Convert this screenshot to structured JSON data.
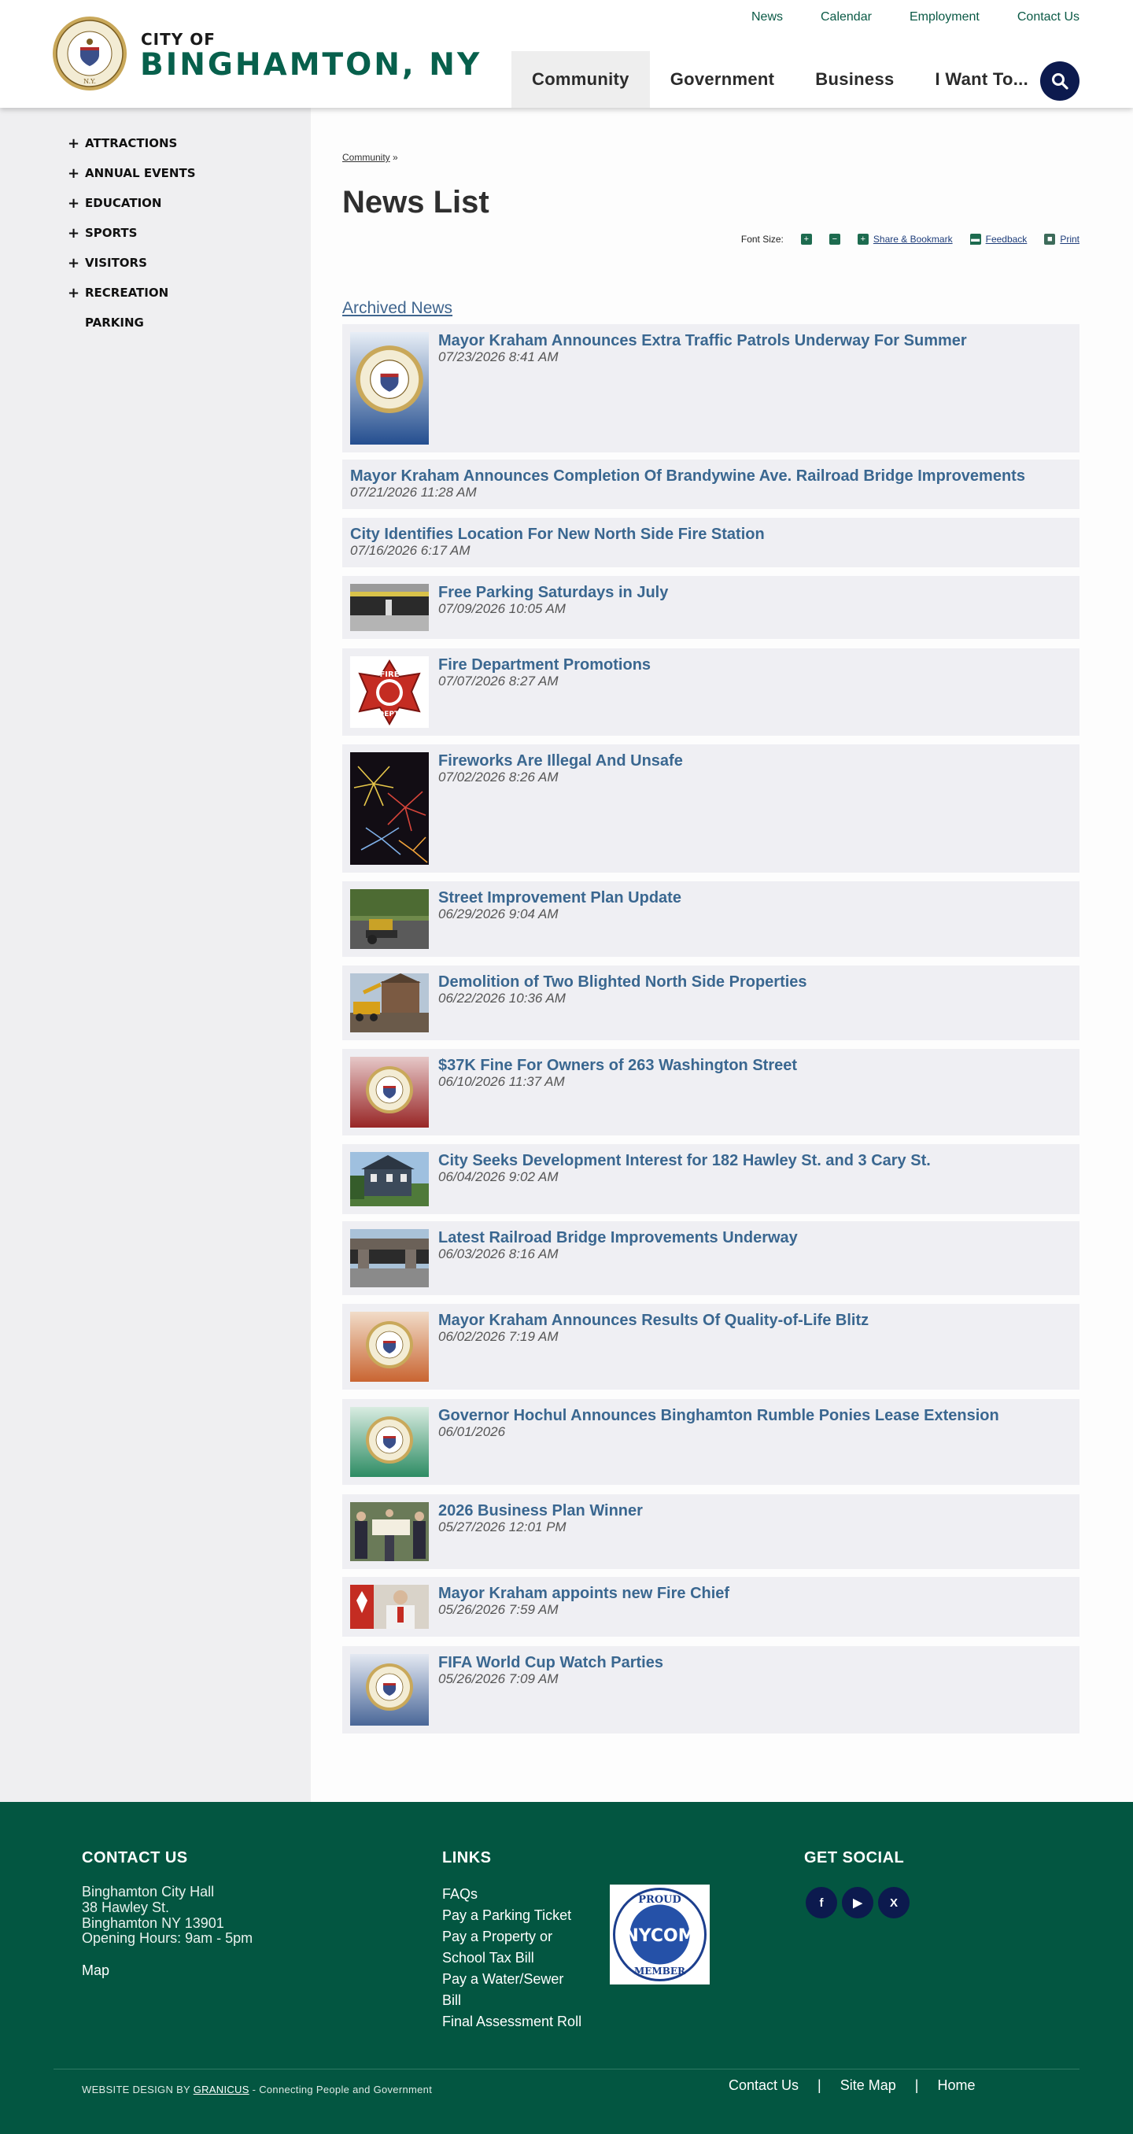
{
  "header": {
    "city_of": "CITY OF",
    "city_name": "BINGHAMTON, NY",
    "utility_nav": [
      "News",
      "Calendar",
      "Employment",
      "Contact Us"
    ],
    "main_nav": [
      "Community",
      "Government",
      "Business",
      "I Want To..."
    ],
    "search_icon": "search-icon"
  },
  "sidebar": {
    "items": [
      {
        "label": "ATTRACTIONS",
        "expandable": true
      },
      {
        "label": "ANNUAL EVENTS",
        "expandable": true
      },
      {
        "label": "EDUCATION",
        "expandable": true
      },
      {
        "label": "SPORTS",
        "expandable": true
      },
      {
        "label": "VISITORS",
        "expandable": true
      },
      {
        "label": "RECREATION",
        "expandable": true
      },
      {
        "label": "PARKING",
        "expandable": false
      }
    ]
  },
  "main": {
    "breadcrumb": "Community",
    "breadcrumb_sep": "»",
    "title": "News List",
    "tools": {
      "font_size_label": "Font Size:",
      "share_label": "Share & Bookmark",
      "feedback_label": "Feedback",
      "print_label": "Print"
    },
    "archived_label": "Archived News",
    "news": [
      {
        "title": "Mayor Kraham Announces Extra Traffic Patrols Underway For Summer",
        "date": "07/23/2026 8:41 AM",
        "thumb": "seal-blue"
      },
      {
        "title": "Mayor Kraham Announces Completion Of Brandywine Ave. Railroad Bridge Improvements",
        "date": "07/21/2026 11:28 AM",
        "thumb": "none"
      },
      {
        "title": "City Identifies Location For New North Side Fire Station",
        "date": "07/16/2026 6:17 AM",
        "thumb": "none"
      },
      {
        "title": "Free Parking Saturdays in July",
        "date": "07/09/2026 10:05 AM",
        "thumb": "parking-garage"
      },
      {
        "title": "Fire Department Promotions",
        "date": "07/07/2026 8:27 AM",
        "thumb": "fire-dept-logo"
      },
      {
        "title": "Fireworks Are Illegal And Unsafe",
        "date": "07/02/2026 8:26 AM",
        "thumb": "fireworks"
      },
      {
        "title": "Street Improvement Plan Update",
        "date": "06/29/2026 9:04 AM",
        "thumb": "street-paving"
      },
      {
        "title": "Demolition of Two Blighted North Side Properties",
        "date": "06/22/2026 10:36 AM",
        "thumb": "demolition"
      },
      {
        "title": "$37K Fine For Owners of 263 Washington Street",
        "date": "06/10/2026 11:37 AM",
        "thumb": "seal-red"
      },
      {
        "title": "City Seeks Development Interest for 182 Hawley St. and 3 Cary St.",
        "date": "06/04/2026 9:02 AM",
        "thumb": "house"
      },
      {
        "title": "Latest Railroad Bridge Improvements Underway",
        "date": "06/03/2026 8:16 AM",
        "thumb": "bridge"
      },
      {
        "title": "Mayor Kraham Announces Results Of Quality-of-Life Blitz",
        "date": "06/02/2026 7:19 AM",
        "thumb": "seal-orange"
      },
      {
        "title": "Governor Hochul Announces Binghamton Rumble Ponies Lease Extension",
        "date": "06/01/2026",
        "thumb": "seal-green"
      },
      {
        "title": "2026 Business Plan Winner",
        "date": "05/27/2026 12:01 PM",
        "thumb": "check-presentation"
      },
      {
        "title": "Mayor Kraham appoints new Fire Chief",
        "date": "05/26/2026 7:59 AM",
        "thumb": "fire-chief"
      },
      {
        "title": "FIFA World Cup Watch Parties",
        "date": "05/26/2026 7:09 AM",
        "thumb": "seal-navy"
      }
    ]
  },
  "footer": {
    "contact": {
      "heading": "CONTACT US",
      "lines": [
        "Binghamton City Hall",
        "38 Hawley St.",
        "Binghamton NY 13901",
        "Opening Hours: 9am - 5pm"
      ],
      "map_label": "Map"
    },
    "links": {
      "heading": "LINKS",
      "items": [
        "FAQs",
        "Pay a Parking Ticket",
        "Pay a Property or",
        "School Tax Bill",
        "Pay a Water/Sewer",
        "Bill",
        "Final Assessment Roll"
      ]
    },
    "badge": {
      "top": "PROUD",
      "middle": "NYCOM",
      "bottom": "MEMBER"
    },
    "social": {
      "heading": "GET SOCIAL",
      "icons": [
        "facebook-icon",
        "youtube-icon",
        "x-icon"
      ]
    },
    "credit_prefix": "WEBSITE DESIGN BY",
    "credit_brand": "GRANICUS",
    "credit_suffix": "- Connecting People and Government",
    "bottom_links": [
      "Contact Us",
      "Site Map",
      "Home"
    ],
    "bottom_sep": "|"
  },
  "colors": {
    "brand_green": "#035641",
    "title_green": "#07604c",
    "link_blue": "#3a6790",
    "navy": "#0c1a4e",
    "card_bg": "#efeff3"
  }
}
